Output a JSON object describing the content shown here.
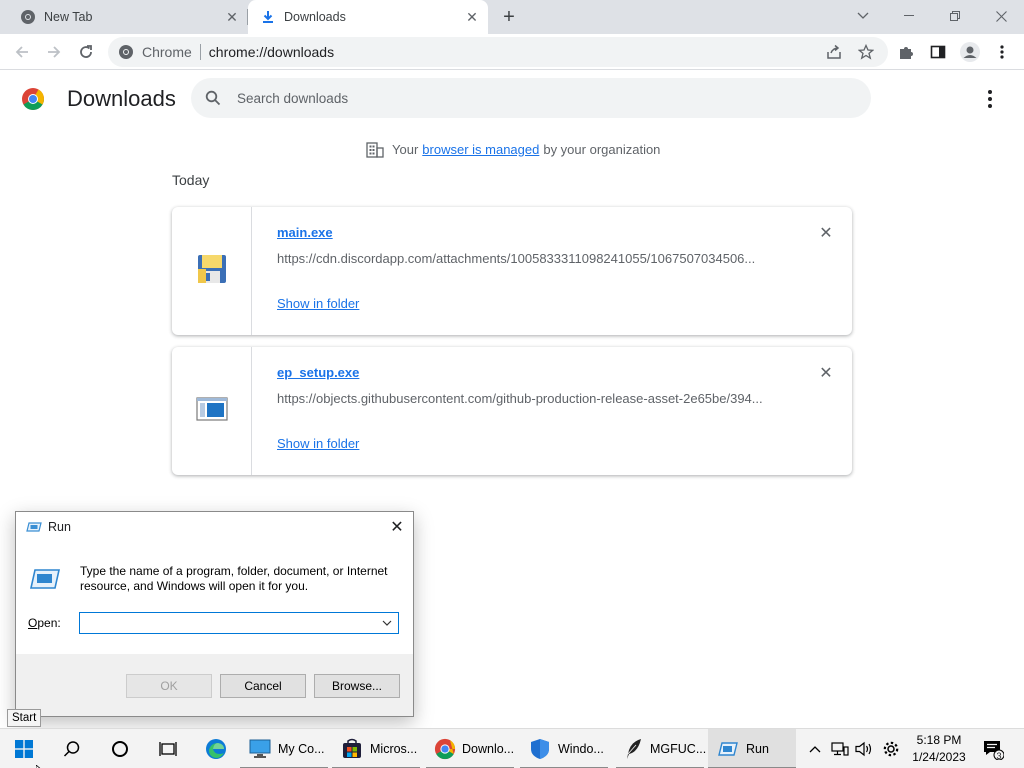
{
  "browser": {
    "tabs": [
      {
        "title": "New Tab",
        "icon": "chrome-icon"
      },
      {
        "title": "Downloads",
        "icon": "download-icon"
      }
    ],
    "omnibox": {
      "chip": "Chrome",
      "url": "chrome://downloads"
    }
  },
  "downloads_page": {
    "title": "Downloads",
    "search_placeholder": "Search downloads",
    "managed": {
      "prefix": "Your",
      "link": "browser is managed",
      "suffix": "by your organization"
    },
    "section": "Today",
    "items": [
      {
        "filename": "main.exe",
        "url": "https://cdn.discordapp.com/attachments/1005833311098241055/1067507034506...",
        "action": "Show in folder",
        "icon": "floppy-disk-icon"
      },
      {
        "filename": "ep_setup.exe",
        "url": "https://objects.githubusercontent.com/github-production-release-asset-2e65be/394...",
        "action": "Show in folder",
        "icon": "window-app-icon"
      }
    ]
  },
  "run_dialog": {
    "title": "Run",
    "description": "Type the name of a program, folder, document, or Internet resource, and Windows will open it for you.",
    "open_label_prefix": "",
    "open_label_underlined": "O",
    "open_label_rest": "pen:",
    "open_value": "",
    "ok": "OK",
    "cancel": "Cancel",
    "browse": "Browse..."
  },
  "tooltip": "Start",
  "taskbar": {
    "apps": [
      {
        "label": "My Co...",
        "icon": "this-pc-icon"
      },
      {
        "label": "Micros...",
        "icon": "microsoft-store-icon"
      },
      {
        "label": "Downlo...",
        "icon": "chrome-icon"
      },
      {
        "label": "Windo...",
        "icon": "windows-security-icon"
      },
      {
        "label": "MGFUC...",
        "icon": "feather-icon"
      },
      {
        "label": "Run",
        "icon": "run-icon"
      }
    ],
    "clock": {
      "time": "5:18 PM",
      "date": "1/24/2023"
    },
    "notification_count": "3"
  },
  "colors": {
    "link": "#1a73e8",
    "tabstrip": "#dee1e6",
    "taskbar": "#f3f3f3"
  }
}
